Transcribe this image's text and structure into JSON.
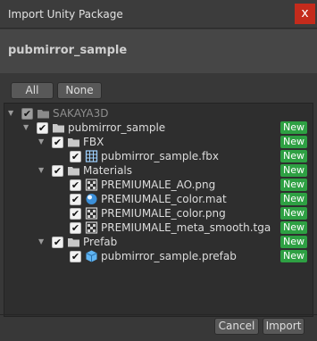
{
  "window": {
    "title": "Import Unity Package",
    "close_label": "x"
  },
  "package": {
    "name": "pubmirror_sample"
  },
  "selection": {
    "all_label": "All",
    "none_label": "None"
  },
  "tree": {
    "root": {
      "label": "SAKAYA3D"
    },
    "items": [
      {
        "label": "pubmirror_sample",
        "badge": "New",
        "icon": "folder-icon"
      },
      {
        "label": "FBX",
        "badge": "New",
        "icon": "folder-icon"
      },
      {
        "label": "pubmirror_sample.fbx",
        "badge": "New",
        "icon": "mesh-icon"
      },
      {
        "label": "Materials",
        "badge": "New",
        "icon": "folder-icon"
      },
      {
        "label": "PREMIUMALE_AO.png",
        "badge": "New",
        "icon": "texture-icon"
      },
      {
        "label": "PREMIUMALE_color.mat",
        "badge": "New",
        "icon": "material-icon"
      },
      {
        "label": "PREMIUMALE_color.png",
        "badge": "New",
        "icon": "texture-icon"
      },
      {
        "label": "PREMIUMALE_meta_smooth.tga",
        "badge": "New",
        "icon": "texture-icon"
      },
      {
        "label": "Prefab",
        "badge": "New",
        "icon": "folder-icon"
      },
      {
        "label": "pubmirror_sample.prefab",
        "badge": "New",
        "icon": "prefab-icon"
      }
    ]
  },
  "footer": {
    "cancel_label": "Cancel",
    "import_label": "Import"
  },
  "colors": {
    "new_badge": "#2ea043",
    "close_button": "#c42b1c",
    "background": "#383838"
  }
}
